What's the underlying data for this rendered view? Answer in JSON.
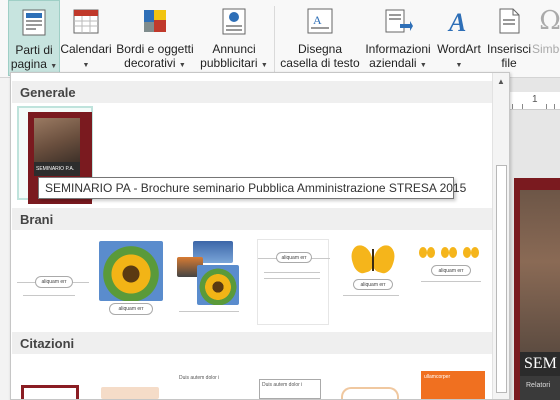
{
  "ribbon": {
    "buttons": [
      {
        "id": "parti",
        "line1": "Parti di",
        "line2": "pagina",
        "icon": "page-parts-icon",
        "dropdown": true
      },
      {
        "id": "calendari",
        "line1": "Calendari",
        "line2": "",
        "icon": "calendar-icon",
        "dropdown": true
      },
      {
        "id": "bordi",
        "line1": "Bordi e oggetti",
        "line2": "decorativi",
        "icon": "borders-icon",
        "dropdown": true
      },
      {
        "id": "annunci",
        "line1": "Annunci",
        "line2": "pubblicitari",
        "icon": "advertisement-icon",
        "dropdown": true
      },
      {
        "id": "casella",
        "line1": "Disegna",
        "line2": "casella di testo",
        "icon": "text-box-icon",
        "dropdown": false
      },
      {
        "id": "info",
        "line1": "Informazioni",
        "line2": "aziendali",
        "icon": "business-info-icon",
        "dropdown": true
      },
      {
        "id": "wordart",
        "line1": "WordArt",
        "line2": "",
        "icon": "wordart-icon",
        "dropdown": true
      },
      {
        "id": "inserisci",
        "line1": "Inserisci",
        "line2": "file",
        "icon": "insert-file-icon",
        "dropdown": false
      },
      {
        "id": "simbolo",
        "line1": "Simbo",
        "line2": "",
        "icon": "symbol-icon",
        "dropdown": false
      }
    ]
  },
  "gallery": {
    "categories": [
      "Generale",
      "Brani",
      "Citazioni"
    ],
    "selected_item": {
      "title_text": "SEMINARIO P.A."
    },
    "tooltip": "SEMINARIO PA - Brochure seminario Pubblica Amministrazione STRESA 2015",
    "brani_text": "aliquam err",
    "citazioni_text": [
      "Duis autem dolor i",
      "Duis autem dolor i",
      "ullamcorper"
    ]
  },
  "document": {
    "ruler_number": "1",
    "page_title": "SEM",
    "page_subtitle": "Relatori"
  },
  "colors": {
    "active_tab": "#c7e4df",
    "brochure_red": "#7a1a1f",
    "wordart_blue": "#2e6fb7"
  }
}
